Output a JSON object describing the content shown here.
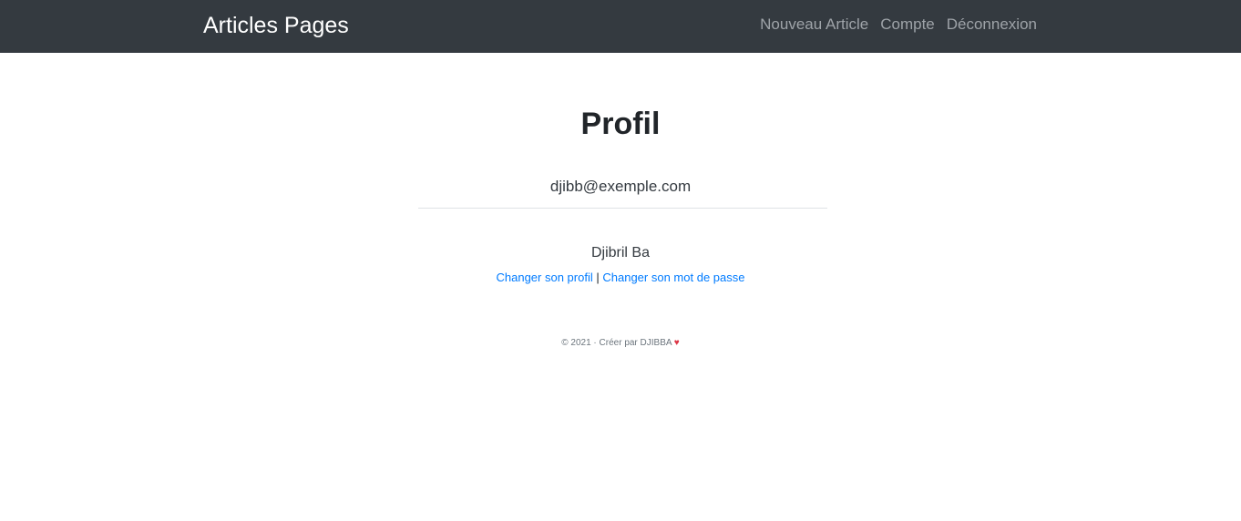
{
  "navbar": {
    "brand": "Articles Pages",
    "links": [
      "Nouveau Article",
      "Compte",
      "Déconnexion"
    ]
  },
  "profile": {
    "title": "Profil",
    "email": "djibb@exemple.com",
    "name": "Djibril Ba",
    "change_profile": "Changer son profil",
    "separator": "|",
    "change_password": "Changer son mot de passe"
  },
  "footer": {
    "text": "© 2021 · Créer par DJIBBA",
    "heart": "♥"
  },
  "colors": {
    "navbar_bg": "#343a40",
    "link": "#007bff",
    "heart": "#dc3545"
  }
}
